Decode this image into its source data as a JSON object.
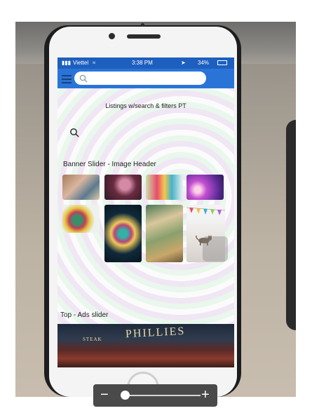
{
  "status_bar": {
    "carrier": "Viettel",
    "time": "3:38 PM",
    "battery": "34%"
  },
  "search": {
    "placeholder": ""
  },
  "listings_title": "Listings w/search & filters PT",
  "banner_section_title": "Banner Slider - Image Header",
  "ads_section_title": "Top - Ads slider",
  "ad_banner": {
    "main_text": "PHILLIES",
    "sub_text": "STEAK"
  },
  "zoom": {
    "minus": "−",
    "plus": "+",
    "level": 0.05
  },
  "colors": {
    "nav_bar": "#2a74d8",
    "status_bar": "#1d5fbf",
    "zoom_bg": "#4a4a4a"
  },
  "icons": [
    "hamburger-icon",
    "search-icon",
    "wifi-icon",
    "battery-icon",
    "cat-image",
    "bunting-image"
  ]
}
